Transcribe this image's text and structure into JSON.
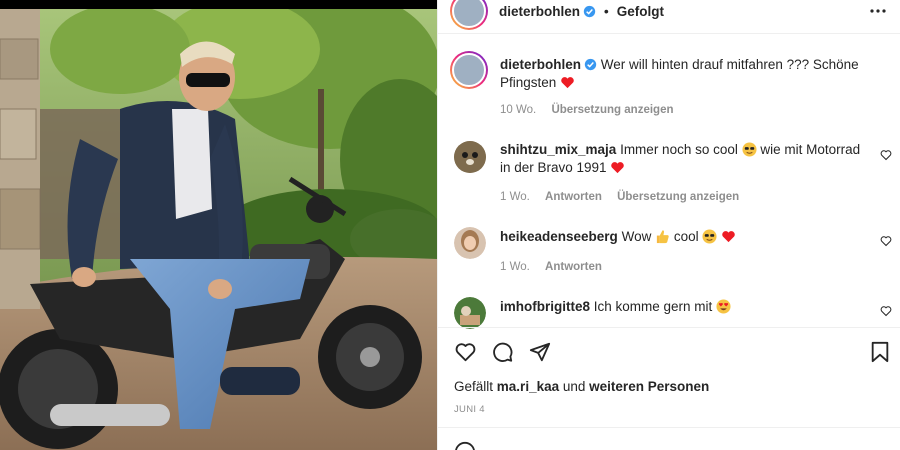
{
  "post": {
    "username": "dieterbohlen",
    "follow_status": "Gefolgt",
    "separator": "•"
  },
  "caption": {
    "username": "dieterbohlen",
    "text": "Wer will hinten drauf mitfahren ??? Schöne Pfingsten",
    "age": "10 Wo.",
    "translate": "Übersetzung anzeigen"
  },
  "comments": [
    {
      "username": "shihtzu_mix_maja",
      "text_before": "Immer noch so cool",
      "text_after": "wie mit Motorrad in der Bravo 1991",
      "age": "1 Wo.",
      "reply": "Antworten",
      "translate": "Übersetzung anzeigen"
    },
    {
      "username": "heikeadenseeberg",
      "text_before": "Wow",
      "text_after": "cool",
      "age": "1 Wo.",
      "reply": "Antworten"
    },
    {
      "username": "imhofbrigitte8",
      "text_before": "Ich komme gern mit"
    }
  ],
  "likes": {
    "prefix": "Gefällt",
    "user": "ma.ri_kaa",
    "middle": "und",
    "suffix": "weiteren Personen"
  },
  "date": "JUNI 4",
  "colors": {
    "text": "#262626",
    "muted": "#8e8e8e",
    "verified": "#3897f0",
    "heart_red": "#ed1c24"
  },
  "icons": [
    "more-icon",
    "verified-icon",
    "heart-icon",
    "comment-icon",
    "share-icon",
    "bookmark-icon",
    "small-heart-icon",
    "smile-icon"
  ]
}
